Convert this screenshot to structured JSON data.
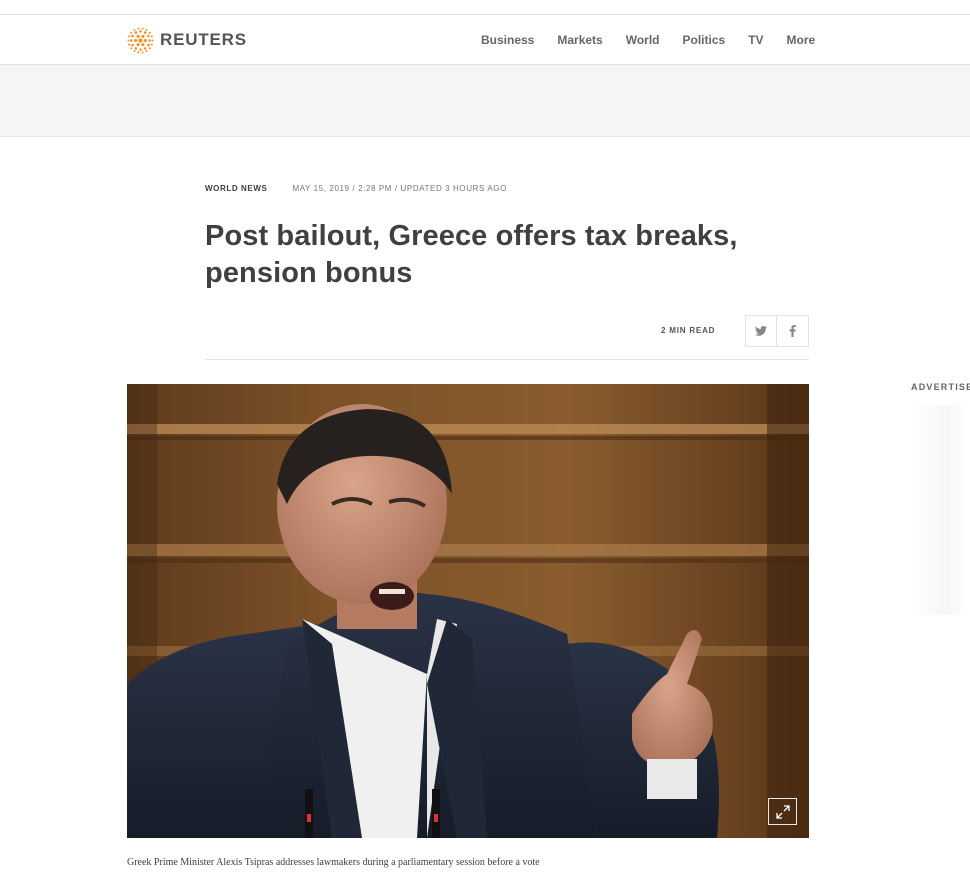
{
  "brand": {
    "name": "REUTERS",
    "logo_icon": "reuters-dots-logo",
    "accent": "#f48c1f"
  },
  "nav": {
    "items": [
      {
        "label": "Business"
      },
      {
        "label": "Markets"
      },
      {
        "label": "World"
      },
      {
        "label": "Politics"
      },
      {
        "label": "TV"
      },
      {
        "label": "More"
      }
    ]
  },
  "article": {
    "section": "World News",
    "dateline": "May 15, 2019 / 2:28 PM / Updated 3 hours ago",
    "headline": "Post bailout, Greece offers tax breaks, pension bonus",
    "read_time": "2 MIN READ",
    "share": {
      "twitter_icon": "twitter-icon",
      "facebook_icon": "facebook-icon"
    },
    "photo": {
      "expand_icon": "expand-icon"
    },
    "caption": "Greek Prime Minister Alexis Tsipras addresses lawmakers during a parliamentary session before a vote"
  },
  "sidebar": {
    "ad_label": "ADVERTISE"
  }
}
